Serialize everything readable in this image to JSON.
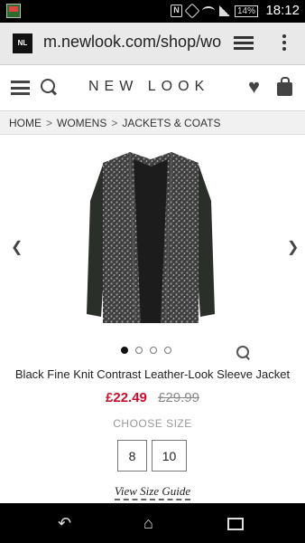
{
  "status_bar": {
    "battery": "14%",
    "time": "18:12",
    "nfc_label": "N"
  },
  "browser": {
    "favicon_label": "NL",
    "url": "m.newlook.com/shop/wo"
  },
  "site": {
    "logo": "NEW LOOK"
  },
  "breadcrumb": {
    "items": [
      "HOME",
      "WOMENS",
      "JACKETS & COATS"
    ],
    "separator": ">"
  },
  "gallery": {
    "prev_glyph": "<",
    "next_glyph": ">",
    "dots_count": 4,
    "active_dot": 0
  },
  "product": {
    "title": "Black Fine Knit Contrast Leather-Look Sleeve Jacket",
    "price_now": "£22.49",
    "price_was": "£29.99",
    "choose_size_label": "CHOOSE SIZE",
    "sizes": [
      "8",
      "10"
    ],
    "size_guide_label": "View Size Guide"
  },
  "colors": {
    "sale_price": "#c8102e",
    "jacket_body": "#3a3a3a",
    "jacket_sleeve": "#2a2e28"
  },
  "icons": {
    "menu": "menu-icon",
    "search": "search-icon",
    "wishlist": "heart-icon",
    "bag": "bag-icon",
    "zoom": "zoom-in-icon"
  }
}
